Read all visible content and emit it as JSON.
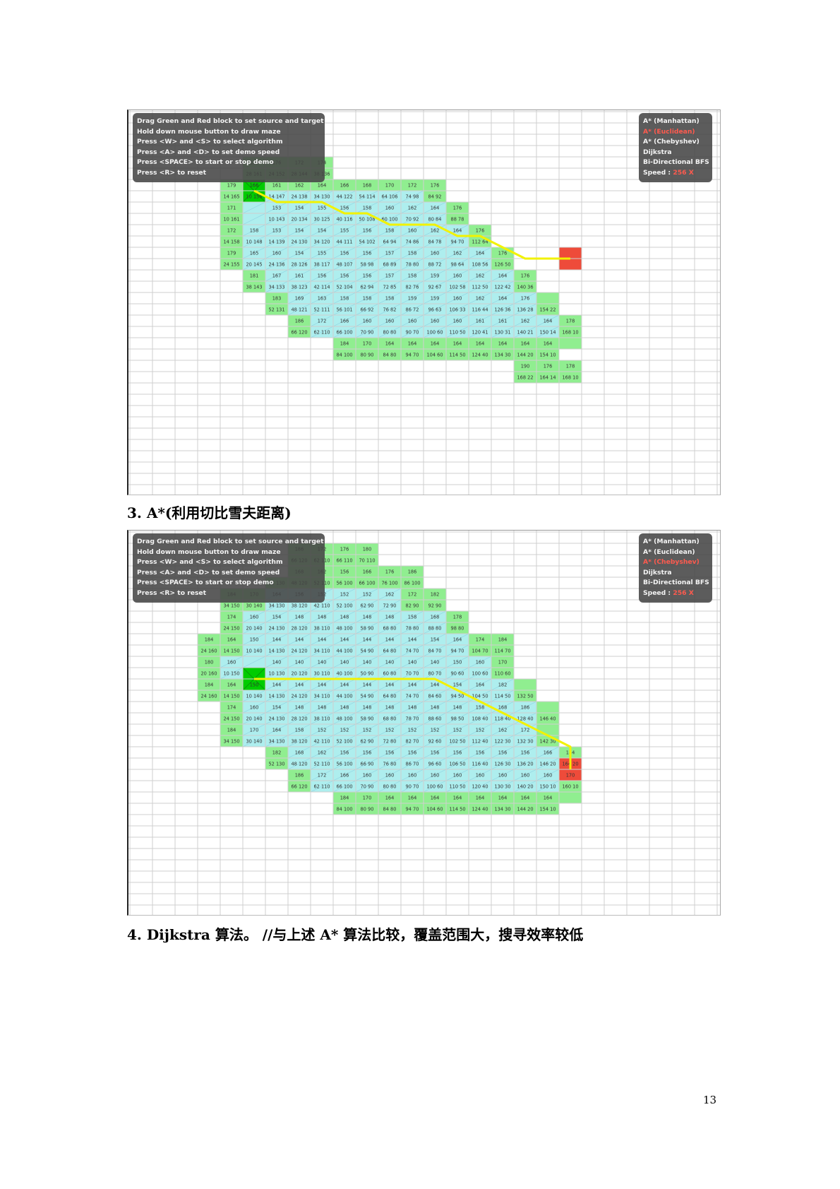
{
  "help_lines": [
    "Drag Green and Red block to set source and target",
    "Hold down mouse button to draw maze",
    "Press <W> and <S> to select algorithm",
    "Press <A> and <D> to set demo speed",
    "Press <SPACE> to start or stop demo",
    "Press <R> to reset"
  ],
  "algorithms": [
    "A* (Manhattan)",
    "A* (Euclidean)",
    "A* (Chebyshev)",
    "Dijkstra",
    "Bi-Directional BFS"
  ],
  "speed_label": "Speed :",
  "speed_value": "256 X",
  "shot1": {
    "selected_algorithm_index": 1,
    "start_cell": [
      5,
      6
    ],
    "goal_cell": [
      19,
      12
    ],
    "path": [
      [
        5,
        6
      ],
      [
        6,
        7
      ],
      [
        7,
        7
      ],
      [
        8,
        7
      ],
      [
        9,
        8
      ],
      [
        10,
        8
      ],
      [
        11,
        9
      ],
      [
        12,
        9
      ],
      [
        13,
        9
      ],
      [
        14,
        10
      ],
      [
        15,
        10
      ],
      [
        16,
        11
      ],
      [
        17,
        12
      ],
      [
        18,
        12
      ],
      [
        19,
        12
      ]
    ],
    "rows": [
      {
        "r": 4,
        "c0": 5,
        "c1": 8,
        "g": [
          "189",
          "176",
          "172",
          "174"
        ]
      },
      {
        "r": 5,
        "c0": 5,
        "c1": 8,
        "g": [
          "28 161",
          "24 152",
          "28 144",
          "38 136"
        ]
      },
      {
        "r": 6,
        "c0": 4,
        "c1": 13,
        "g": [
          "179",
          "166",
          "161",
          "162",
          "164",
          "166",
          "168",
          "170",
          "172",
          "176"
        ]
      },
      {
        "r": 7,
        "c0": 4,
        "c1": 13,
        "g": [
          "14 165",
          "10 156",
          "14 147",
          "24 138",
          "34 130",
          "44 122",
          "54 114",
          "64 106",
          "74 98",
          "84 92"
        ]
      },
      {
        "r": 8,
        "c0": 4,
        "c1": 14,
        "g": [
          "171",
          "",
          "153",
          "154",
          "155",
          "156",
          "158",
          "160",
          "162",
          "164",
          "176"
        ]
      },
      {
        "r": 9,
        "c0": 4,
        "c1": 14,
        "g": [
          "10 161",
          "",
          "10 143",
          "20 134",
          "30 125",
          "40 116",
          "50 108",
          "60 100",
          "70 92",
          "80 84",
          "88 78"
        ]
      },
      {
        "r": 10,
        "c0": 4,
        "c1": 15,
        "g": [
          "172",
          "158",
          "153",
          "154",
          "154",
          "155",
          "156",
          "158",
          "160",
          "162",
          "164",
          "176"
        ]
      },
      {
        "r": 11,
        "c0": 4,
        "c1": 15,
        "g": [
          "14 158",
          "10 148",
          "14 139",
          "24 130",
          "34 120",
          "44 111",
          "54 102",
          "64 94",
          "74 86",
          "84 78",
          "94 70",
          "112 64"
        ]
      },
      {
        "r": 12,
        "c0": 4,
        "c1": 16,
        "g": [
          "179",
          "165",
          "160",
          "154",
          "155",
          "156",
          "156",
          "157",
          "158",
          "160",
          "162",
          "164",
          "176"
        ]
      },
      {
        "r": 13,
        "c0": 4,
        "c1": 16,
        "g": [
          "24 155",
          "20 145",
          "24 136",
          "28 126",
          "38 117",
          "48 107",
          "58 98",
          "68 89",
          "78 80",
          "88 72",
          "98 64",
          "108 56",
          "126 50"
        ]
      },
      {
        "r": 14,
        "c0": 5,
        "c1": 17,
        "g": [
          "181",
          "167",
          "161",
          "156",
          "156",
          "156",
          "157",
          "158",
          "159",
          "160",
          "162",
          "164",
          "176"
        ]
      },
      {
        "r": 15,
        "c0": 5,
        "c1": 17,
        "g": [
          "38 143",
          "34 133",
          "38 123",
          "42 114",
          "52 104",
          "62 94",
          "72 85",
          "82 76",
          "92 67",
          "102 58",
          "112 50",
          "122 42",
          "140 36"
        ]
      },
      {
        "r": 16,
        "c0": 6,
        "c1": 18,
        "g": [
          "183",
          "169",
          "163",
          "158",
          "158",
          "158",
          "159",
          "159",
          "160",
          "162",
          "164",
          "176"
        ]
      },
      {
        "r": 17,
        "c0": 6,
        "c1": 18,
        "g": [
          "52 131",
          "48 121",
          "52 111",
          "56 101",
          "66 92",
          "76 82",
          "86 72",
          "96 63",
          "106 33",
          "116 44",
          "126 36",
          "136 28",
          "154 22"
        ]
      },
      {
        "r": 18,
        "c0": 7,
        "c1": 19,
        "g": [
          "186",
          "172",
          "166",
          "160",
          "160",
          "160",
          "160",
          "160",
          "161",
          "161",
          "162",
          "164",
          "178"
        ]
      },
      {
        "r": 19,
        "c0": 7,
        "c1": 19,
        "g": [
          "66 120",
          "62 110",
          "66 100",
          "70 90",
          "80 80",
          "90 70",
          "100 60",
          "110 50",
          "120 41",
          "130 31",
          "140 21",
          "150 14",
          "168 10"
        ]
      },
      {
        "r": 20,
        "c0": 9,
        "c1": 19,
        "g": [
          "184",
          "170",
          "164",
          "164",
          "164",
          "164",
          "164",
          "164",
          "164",
          "164",
          ""
        ]
      },
      {
        "r": 21,
        "c0": 9,
        "c1": 18,
        "g": [
          "84 100",
          "80 90",
          "84 80",
          "94 70",
          "104 60",
          "114 50",
          "124 40",
          "134 30",
          "144 20",
          "154 10"
        ]
      },
      {
        "r": 22,
        "c0": 17,
        "c1": 19,
        "g": [
          "190",
          "176",
          "178"
        ]
      },
      {
        "r": 23,
        "c0": 17,
        "c1": 19,
        "g": [
          "168 22",
          "164 14",
          "168 10"
        ]
      }
    ],
    "blue_rows": [
      [
        7,
        5,
        12
      ],
      [
        8,
        5,
        13
      ],
      [
        9,
        5,
        13
      ],
      [
        10,
        5,
        14
      ],
      [
        11,
        5,
        14
      ],
      [
        12,
        5,
        15
      ],
      [
        13,
        5,
        15
      ],
      [
        14,
        6,
        16
      ],
      [
        15,
        6,
        16
      ],
      [
        16,
        7,
        17
      ],
      [
        17,
        7,
        17
      ],
      [
        18,
        8,
        18
      ],
      [
        19,
        8,
        18
      ]
    ]
  },
  "caption3": "3. A*(利用切比雪夫距离)",
  "shot2": {
    "selected_algorithm_index": 2,
    "start_cell": [
      5,
      12
    ],
    "goal_cell": [
      19,
      20
    ],
    "path": [
      [
        5,
        12
      ],
      [
        6,
        12
      ],
      [
        7,
        12
      ],
      [
        8,
        12
      ],
      [
        9,
        12
      ],
      [
        10,
        12
      ],
      [
        11,
        12
      ],
      [
        12,
        12
      ],
      [
        13,
        12
      ],
      [
        14,
        13
      ],
      [
        15,
        14
      ],
      [
        16,
        15
      ],
      [
        17,
        16
      ],
      [
        18,
        17
      ],
      [
        19,
        18
      ],
      [
        19,
        19
      ],
      [
        19,
        20
      ]
    ],
    "rows": [
      {
        "r": 1,
        "c0": 7,
        "c1": 10,
        "g": [
          "186",
          "172",
          "176",
          "180"
        ]
      },
      {
        "r": 2,
        "c0": 7,
        "c1": 10,
        "g": [
          "66 120",
          "62 110",
          "66 110",
          "70 110"
        ]
      },
      {
        "r": 3,
        "c0": 7,
        "c1": 12,
        "g": [
          "168",
          "162",
          "156",
          "166",
          "176",
          "186"
        ]
      },
      {
        "r": 4,
        "c0": 6,
        "c1": 12,
        "g": [
          "52 130",
          "48 120",
          "52 110",
          "56 100",
          "66 100",
          "76 100",
          "86 100"
        ]
      },
      {
        "r": 5,
        "c0": 4,
        "c1": 13,
        "g": [
          "184",
          "170",
          "164",
          "156",
          "152",
          "152",
          "152",
          "162",
          "172",
          "182"
        ]
      },
      {
        "r": 6,
        "c0": 4,
        "c1": 13,
        "g": [
          "34 150",
          "30 140",
          "34 130",
          "38 120",
          "42 110",
          "52 100",
          "62 90",
          "72 90",
          "82 90",
          "92 90"
        ]
      },
      {
        "r": 7,
        "c0": 4,
        "c1": 14,
        "g": [
          "174",
          "160",
          "154",
          "148",
          "148",
          "148",
          "148",
          "148",
          "158",
          "168",
          "178"
        ]
      },
      {
        "r": 8,
        "c0": 4,
        "c1": 14,
        "g": [
          "24 150",
          "20 140",
          "24 130",
          "28 120",
          "38 110",
          "48 100",
          "58 90",
          "68 80",
          "78 80",
          "88 80",
          "98 80"
        ]
      },
      {
        "r": 9,
        "c0": 3,
        "c1": 16,
        "g": [
          "184",
          "164",
          "150",
          "144",
          "144",
          "144",
          "144",
          "144",
          "144",
          "144",
          "154",
          "164",
          "174",
          "184"
        ]
      },
      {
        "r": 10,
        "c0": 3,
        "c1": 16,
        "g": [
          "24 160",
          "14 150",
          "10 140",
          "14 130",
          "24 120",
          "34 110",
          "44 100",
          "54 90",
          "64 80",
          "74 70",
          "84 70",
          "94 70",
          "104 70",
          "114 70"
        ]
      },
      {
        "r": 11,
        "c0": 3,
        "c1": 16,
        "g": [
          "180",
          "160",
          "",
          "140",
          "140",
          "140",
          "140",
          "140",
          "140",
          "140",
          "140",
          "150",
          "160",
          "170"
        ]
      },
      {
        "r": 12,
        "c0": 3,
        "c1": 16,
        "g": [
          "20 160",
          "10 150",
          "",
          "10 130",
          "20 120",
          "30 110",
          "40 100",
          "50 90",
          "60 80",
          "70 70",
          "80 70",
          "90 60",
          "100 60",
          "110 60"
        ]
      },
      {
        "r": 13,
        "c0": 3,
        "c1": 17,
        "g": [
          "184",
          "164",
          "150",
          "144",
          "144",
          "144",
          "144",
          "144",
          "144",
          "144",
          "144",
          "154",
          "164",
          "182"
        ]
      },
      {
        "r": 14,
        "c0": 3,
        "c1": 17,
        "g": [
          "24 160",
          "14 150",
          "10 140",
          "14 130",
          "24 120",
          "34 110",
          "44 100",
          "54 90",
          "64 80",
          "74 70",
          "84 60",
          "94 50",
          "104 50",
          "114 50",
          "132 50"
        ]
      },
      {
        "r": 15,
        "c0": 4,
        "c1": 18,
        "g": [
          "174",
          "160",
          "154",
          "148",
          "148",
          "148",
          "148",
          "148",
          "148",
          "148",
          "148",
          "158",
          "168",
          "186"
        ]
      },
      {
        "r": 16,
        "c0": 4,
        "c1": 18,
        "g": [
          "24 150",
          "20 140",
          "24 130",
          "28 120",
          "38 110",
          "48 100",
          "58 90",
          "68 80",
          "78 70",
          "88 60",
          "98 50",
          "108 40",
          "118 40",
          "128 40",
          "146 40"
        ]
      },
      {
        "r": 17,
        "c0": 4,
        "c1": 18,
        "g": [
          "184",
          "170",
          "164",
          "158",
          "152",
          "152",
          "152",
          "152",
          "152",
          "152",
          "152",
          "152",
          "162",
          "172"
        ]
      },
      {
        "r": 18,
        "c0": 4,
        "c1": 18,
        "g": [
          "34 150",
          "30 140",
          "34 130",
          "38 120",
          "42 110",
          "52 100",
          "62 90",
          "72 80",
          "82 70",
          "92 60",
          "102 50",
          "112 40",
          "122 30",
          "132 30",
          "142 30"
        ]
      },
      {
        "r": 19,
        "c0": 6,
        "c1": 19,
        "g": [
          "182",
          "168",
          "162",
          "156",
          "156",
          "156",
          "156",
          "156",
          "156",
          "156",
          "156",
          "156",
          "166",
          "184"
        ]
      },
      {
        "r": 20,
        "c0": 6,
        "c1": 19,
        "g": [
          "52 130",
          "48 120",
          "52 110",
          "56 100",
          "66 90",
          "76 80",
          "86 70",
          "96 60",
          "106 50",
          "116 40",
          "126 30",
          "136 20",
          "146 20",
          "164 20"
        ]
      },
      {
        "r": 21,
        "c0": 7,
        "c1": 19,
        "g": [
          "186",
          "172",
          "166",
          "160",
          "160",
          "160",
          "160",
          "160",
          "160",
          "160",
          "160",
          "160",
          "170"
        ]
      },
      {
        "r": 22,
        "c0": 7,
        "c1": 19,
        "g": [
          "66 120",
          "62 110",
          "66 100",
          "70 90",
          "80 80",
          "90 70",
          "100 60",
          "110 50",
          "120 40",
          "130 30",
          "140 20",
          "150 10",
          "160 10"
        ]
      },
      {
        "r": 23,
        "c0": 9,
        "c1": 19,
        "g": [
          "184",
          "170",
          "164",
          "164",
          "164",
          "164",
          "164",
          "164",
          "164",
          "164",
          ""
        ]
      },
      {
        "r": 24,
        "c0": 9,
        "c1": 18,
        "g": [
          "84 100",
          "80 90",
          "84 80",
          "94 70",
          "104 60",
          "114 50",
          "124 40",
          "134 30",
          "144 20",
          "154 10"
        ]
      }
    ],
    "blue_rows": [
      [
        5,
        6,
        11
      ],
      [
        6,
        6,
        11
      ],
      [
        7,
        5,
        13
      ],
      [
        8,
        5,
        13
      ],
      [
        9,
        5,
        14
      ],
      [
        10,
        5,
        14
      ],
      [
        11,
        4,
        15
      ],
      [
        12,
        4,
        15
      ],
      [
        13,
        5,
        16
      ],
      [
        14,
        5,
        16
      ],
      [
        15,
        5,
        17
      ],
      [
        16,
        5,
        17
      ],
      [
        17,
        5,
        17
      ],
      [
        18,
        5,
        17
      ],
      [
        19,
        7,
        18
      ],
      [
        20,
        7,
        18
      ],
      [
        21,
        8,
        18
      ],
      [
        22,
        8,
        18
      ]
    ]
  },
  "caption4": "4. Dijkstra 算法。 //与上述 A* 算法比较，覆盖范围大，搜寻效率较低",
  "page_number": "13",
  "colors": {
    "open": "#90ee90",
    "closed": "#aeeeee",
    "start": "#00cc00",
    "goal": "#ee4b3a",
    "path": "#f2f200",
    "grid": "#cfcfcf",
    "panel": "#464646",
    "selected": "#ff5a4e"
  }
}
